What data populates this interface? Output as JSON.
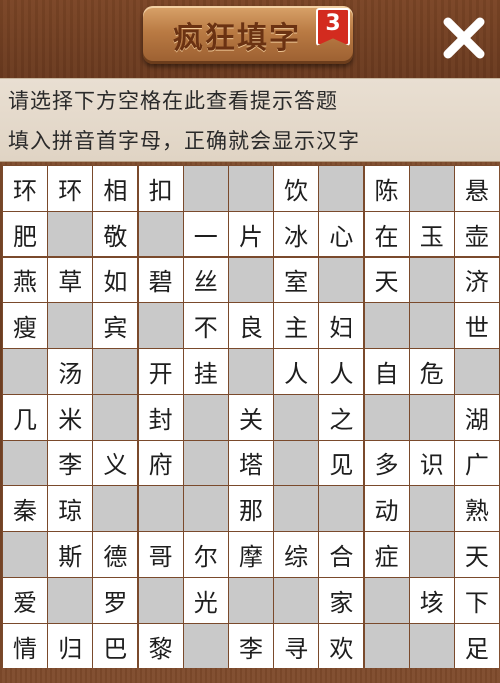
{
  "header": {
    "title": "疯狂填字",
    "level": "3",
    "close_icon": "close-icon"
  },
  "hint": {
    "line1": "请选择下方空格在此查看提示答题",
    "line2": "填入拼音首字母，正确就会显示汉字"
  },
  "grid": {
    "rows": [
      [
        "环",
        "环",
        "相",
        "扣",
        "",
        "",
        "饮",
        "",
        "陈",
        "",
        "悬"
      ],
      [
        "肥",
        "",
        "敬",
        "",
        "一",
        "片",
        "冰",
        "心",
        "在",
        "玉",
        "壶"
      ],
      [
        "燕",
        "草",
        "如",
        "碧",
        "丝",
        "",
        "室",
        "",
        "天",
        "",
        "济"
      ],
      [
        "瘦",
        "",
        "宾",
        "",
        "不",
        "良",
        "主",
        "妇",
        "",
        "",
        "世"
      ],
      [
        "",
        "汤",
        "",
        "开",
        "挂",
        "",
        "人",
        "人",
        "自",
        "危",
        ""
      ],
      [
        "几",
        "米",
        "",
        "封",
        "",
        "关",
        "",
        "之",
        "",
        "",
        "湖"
      ],
      [
        "",
        "李",
        "义",
        "府",
        "",
        "塔",
        "",
        "见",
        "多",
        "识",
        "广"
      ],
      [
        "秦",
        "琼",
        "",
        "",
        "",
        "那",
        "",
        "",
        "动",
        "",
        "熟"
      ],
      [
        "",
        "斯",
        "德",
        "哥",
        "尔",
        "摩",
        "综",
        "合",
        "症",
        "",
        "天"
      ],
      [
        "爱",
        "",
        "罗",
        "",
        "光",
        "",
        "",
        "家",
        "",
        "垓",
        "下"
      ],
      [
        "情",
        "归",
        "巴",
        "黎",
        "",
        "李",
        "寻",
        "欢",
        "",
        "",
        "足"
      ]
    ]
  },
  "colors": {
    "wood": "#7b4526",
    "plaque": "#c38a52",
    "badge": "#d32b1f",
    "cell_filled": "#ffffff",
    "cell_empty": "#c9c9c9"
  }
}
